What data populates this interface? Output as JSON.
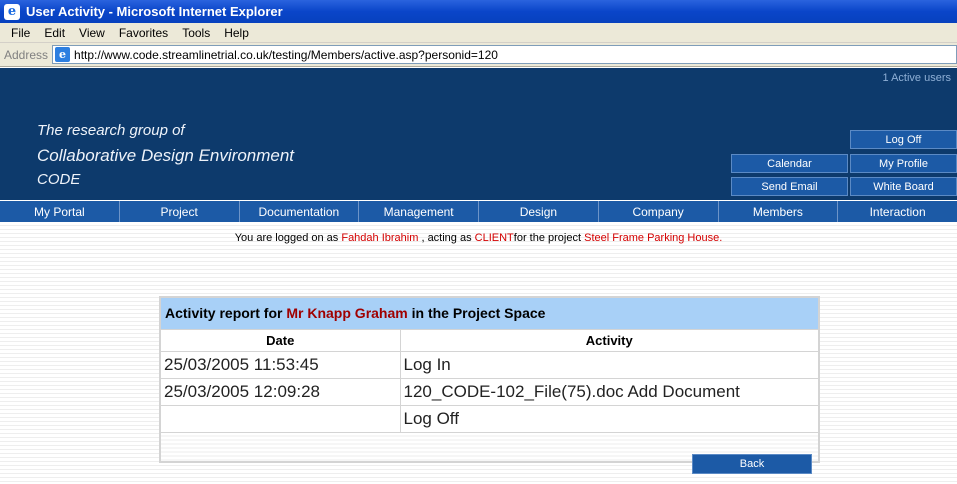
{
  "window": {
    "title": "User Activity - Microsoft Internet Explorer"
  },
  "menu": [
    "File",
    "Edit",
    "View",
    "Favorites",
    "Tools",
    "Help"
  ],
  "address": {
    "label": "Address",
    "url": "http://www.code.streamlinetrial.co.uk/testing/Members/active.asp?personid=120"
  },
  "banner": {
    "line1": "The research group of",
    "line2": "Collaborative Design Environment",
    "line3": "CODE",
    "active_users": "1 Active users",
    "buttons": {
      "log_off": "Log Off",
      "calendar": "Calendar",
      "my_profile": "My Profile",
      "send_email": "Send Email",
      "white_board": "White Board"
    }
  },
  "nav": [
    "My Portal",
    "Project",
    "Documentation",
    "Management",
    "Design",
    "Company",
    "Members",
    "Interaction"
  ],
  "status": {
    "prefix": "You are logged on as",
    "user": "Fahdah  Ibrahim",
    "middle": ", acting as",
    "role": "CLIENT",
    "suffix": "for the project",
    "project": "Steel Frame Parking House."
  },
  "report": {
    "title_prefix": "Activity report for",
    "person": "Mr Knapp Graham",
    "title_suffix": "in the Project Space",
    "columns": [
      "Date",
      "Activity"
    ],
    "rows": [
      {
        "date": "25/03/2005 11:53:45",
        "activity": "Log In"
      },
      {
        "date": "25/03/2005 12:09:28",
        "activity": "120_CODE-102_File(75).doc Add Document"
      },
      {
        "date": "",
        "activity": "Log Off"
      }
    ],
    "back_label": "Back"
  }
}
